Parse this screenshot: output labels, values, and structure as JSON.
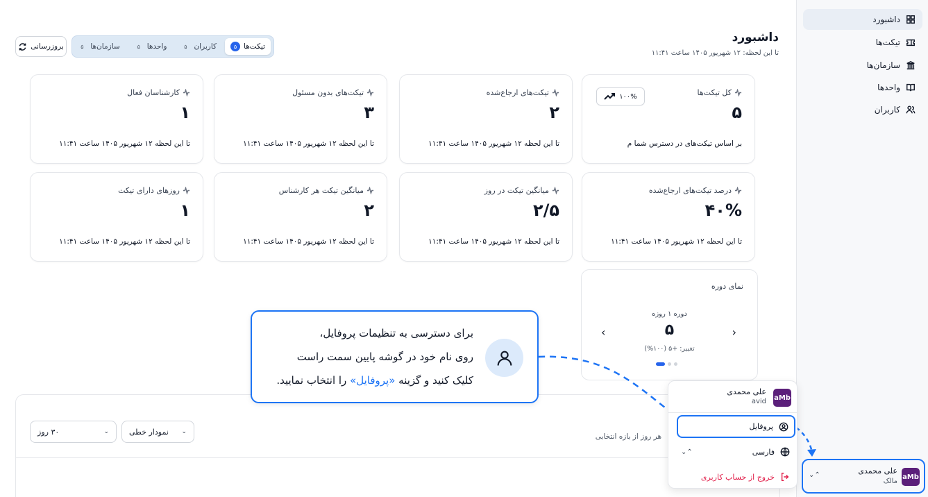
{
  "sidebar": {
    "items": [
      {
        "label": "داشبورد",
        "icon": "grid-icon",
        "active": true
      },
      {
        "label": "تیکت‌ها",
        "icon": "ticket-icon",
        "active": false
      },
      {
        "label": "سازمان‌ها",
        "icon": "building-icon",
        "active": false
      },
      {
        "label": "واحدها",
        "icon": "book-icon",
        "active": false
      },
      {
        "label": "کاربران",
        "icon": "users-icon",
        "active": false
      }
    ],
    "user": {
      "name": "علی محمدی",
      "role": "مالک",
      "avatar_text": "aMb"
    }
  },
  "header": {
    "title": "داشبورد",
    "subtitle": "تا این لحظه: ۱۲ شهریور ۱۴۰۵ ساعت ۱۱:۴۱",
    "refresh_label": "بروزرسانی",
    "tabs": [
      {
        "label": "تیکت‌ها",
        "count": "۵",
        "active": true
      },
      {
        "label": "کاربران",
        "count": "۵",
        "active": false
      },
      {
        "label": "واحدها",
        "count": "۵",
        "active": false
      },
      {
        "label": "سازمان‌ها",
        "count": "۵",
        "active": false
      }
    ]
  },
  "cards": [
    {
      "label": "کل تیکت‌ها",
      "value": "۵",
      "footer": "بر اساس تیکت‌های در دسترس شما م",
      "badge": "۱۰۰%"
    },
    {
      "label": "تیکت‌های ارجاع‌شده",
      "value": "۲",
      "footer": "تا این لحظه ۱۲ شهریور ۱۴۰۵ ساعت ۱۱:۴۱"
    },
    {
      "label": "تیکت‌های بدون مسئول",
      "value": "۳",
      "footer": "تا این لحظه ۱۲ شهریور ۱۴۰۵ ساعت ۱۱:۴۱"
    },
    {
      "label": "کارشناسان فعال",
      "value": "۱",
      "footer": "تا این لحظه ۱۲ شهریور ۱۴۰۵ ساعت ۱۱:۴۱"
    },
    {
      "label": "درصد تیکت‌های ارجاع‌شده",
      "value": "۴۰%",
      "footer": "تا این لحظه ۱۲ شهریور ۱۴۰۵ ساعت ۱۱:۴۱"
    },
    {
      "label": "میانگین تیکت در روز",
      "value": "۲/۵",
      "footer": "تا این لحظه ۱۲ شهریور ۱۴۰۵ ساعت ۱۱:۴۱"
    },
    {
      "label": "میانگین تیکت هر کارشناس",
      "value": "۲",
      "footer": "تا این لحظه ۱۲ شهریور ۱۴۰۵ ساعت ۱۱:۴۱"
    },
    {
      "label": "روزهای دارای تیکت",
      "value": "۱",
      "footer": "تا این لحظه ۱۲ شهریور ۱۴۰۵ ساعت ۱۱:۴۱"
    }
  ],
  "period": {
    "title": "نمای دوره",
    "label": "دوره ۱ روزه",
    "value": "۵",
    "change": "تغییر: +۵ (۱۰۰%)",
    "prev_arrow": "‹",
    "next_arrow": "›"
  },
  "chart_panel": {
    "hint": "هر روز از بازه انتخابی",
    "chart_type_select": "نمودار خطی",
    "range_select": "۳۰ روز"
  },
  "tooltip": {
    "line1": "برای دسترسی به تنظیمات پروفایل،",
    "line2": "روی نام خود در گوشه پایین سمت راست",
    "line3_a": "کلیک کنید و گزینه ",
    "line3_hl": "«پروفایل»",
    "line3_b": " را انتخاب نمایید."
  },
  "profile_menu": {
    "name": "علی محمدی",
    "sub": "avid",
    "avatar_text": "aMb",
    "profile_label": "پروفایل",
    "language_label": "فارسی",
    "logout_label": "خروج از حساب کاربری"
  },
  "colors": {
    "accent": "#1d74f5",
    "logout": "#e11d48",
    "avatar_bg": "#5b1f7a"
  }
}
